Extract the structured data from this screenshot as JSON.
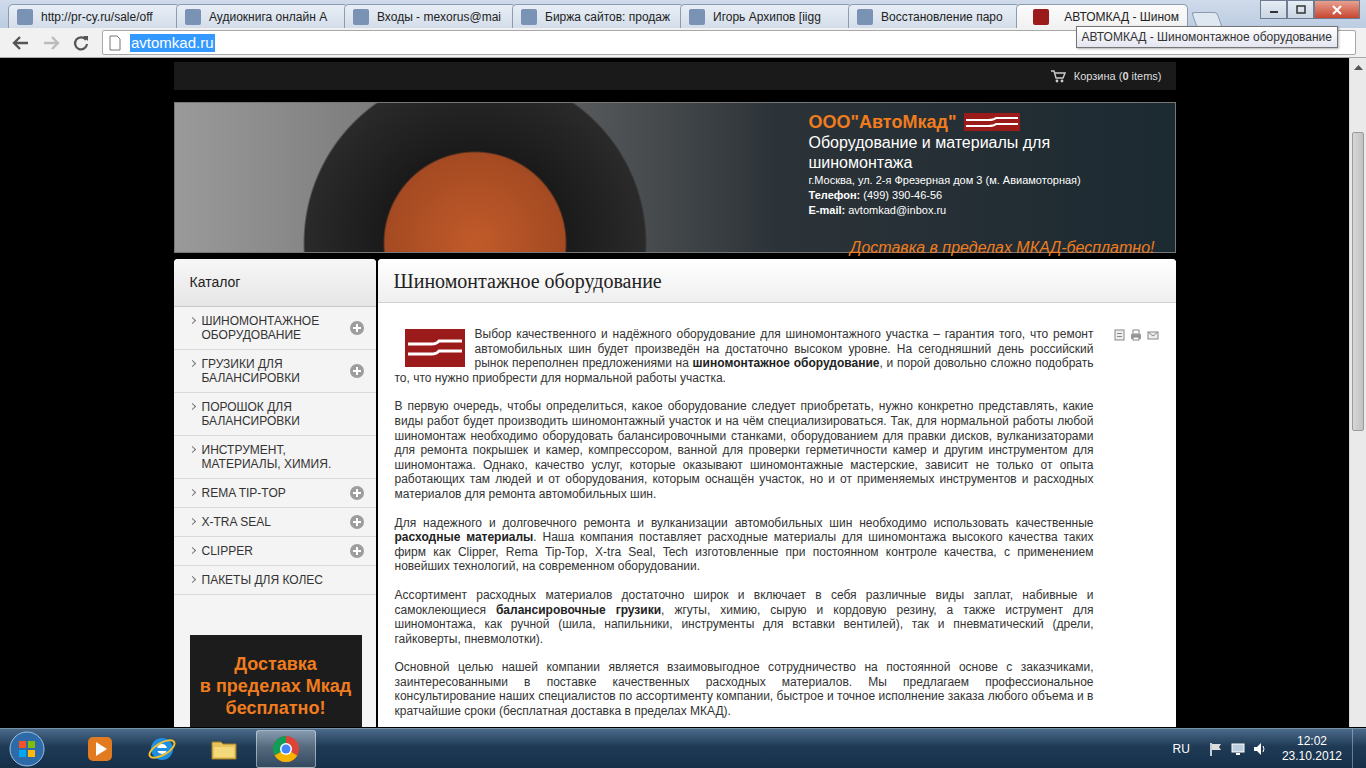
{
  "browser": {
    "tabs": [
      {
        "label": "http://pr-cy.ru/sale/off",
        "selected": false
      },
      {
        "label": "Аудиокнига онлайн А",
        "selected": false
      },
      {
        "label": "Входы - mexorus@mai",
        "selected": false
      },
      {
        "label": "Биржа сайтов: продаж",
        "selected": false
      },
      {
        "label": "Игорь Архипов [iigg",
        "selected": false
      },
      {
        "label": "Восстановление паро",
        "selected": false
      },
      {
        "label": "АВТОМКАД - Шином",
        "selected": true
      }
    ],
    "tooltip": "АВТОМКАД - Шиномонтажное оборудование",
    "url": "avtomkad.ru",
    "url_selected": true,
    "scrollbar": {
      "thumb_start": 0.09,
      "thumb_size": 0.47
    }
  },
  "site": {
    "cart": {
      "prefix": "Корзина (",
      "count": "0",
      "suffix": " items)"
    },
    "header": {
      "company": "ООО\"АвтоМкад\"",
      "subtitle": "Оборудование и материалы для шиномонтажа",
      "address": "г.Москва, ул. 2-я Фрезерная дом 3 (м. Авиамоторная)",
      "phone_label": "Телефон:",
      "phone": " (499) 390-46-56",
      "email_label": "E-mail:",
      "email": " avtomkad@inbox.ru",
      "delivery": "Доставка в пределах МКАД-бесплатно!"
    },
    "sidebar": {
      "title": "Каталог",
      "items": [
        {
          "label": "ШИНОМОНТАЖНОЕ ОБОРУДОВАНИЕ",
          "has_children": true
        },
        {
          "label": "ГРУЗИКИ ДЛЯ БАЛАНСИРОВКИ",
          "has_children": true
        },
        {
          "label": "ПОРОШОК ДЛЯ БАЛАНСИРОВКИ",
          "has_children": false
        },
        {
          "label": "ИНСТРУМЕНТ, МАТЕРИАЛЫ, ХИМИЯ.",
          "has_children": false
        },
        {
          "label": "REMA TIP-TOP",
          "has_children": true
        },
        {
          "label": "X-TRA SEAL",
          "has_children": true
        },
        {
          "label": "CLIPPER",
          "has_children": true
        },
        {
          "label": "ПАКЕТЫ ДЛЯ КОЛЕС",
          "has_children": false
        }
      ],
      "promo_lines": [
        "Доставка",
        "в пределах Мкад",
        "бесплатно!"
      ]
    },
    "content": {
      "title": "Шиномонтажное оборудование",
      "paragraphs": [
        [
          {
            "text": "Выбор качественного и надёжного оборудование для шиномонтажного участка – гарантия того, что ремонт автомобильных шин будет произведён на достаточно высоком уровне. На сегодняшний день российский рынок переполнен предложениями на ",
            "bold": false
          },
          {
            "text": "шиномонтажное оборудование",
            "bold": true
          },
          {
            "text": ", и порой довольно сложно подобрать то, что нужно приобрести для нормальной работы участка.",
            "bold": false
          }
        ],
        [
          {
            "text": "В первую очередь, чтобы определиться, какое оборудование следует приобретать, нужно конкретно представлять, какие виды работ будет производить шиномонтажный участок и на чём специализироваться. Так, для нормальной работы любой шиномонтаж необходимо оборудовать балансировочными станками, оборудованием для правки дисков, вулканизаторами для ремонта покрышек и камер, компрессором, ванной для проверки герметичности камер и другим инструментом для шиномонтажа. Однако, качество услуг, которые оказывают шиномонтажные мастерские, зависит не только от опыта работающих там людей и от оборудования, которым оснащён участок, но и от применяемых инструментов и расходных материалов для ремонта автомобильных шин.",
            "bold": false
          }
        ],
        [
          {
            "text": "Для надежного и долговечного ремонта и вулканизации автомобильных шин необходимо использовать качественные ",
            "bold": false
          },
          {
            "text": "расходные материалы",
            "bold": true
          },
          {
            "text": ". Наша компания поставляет расходные материалы для шиномонтажа высокого качества таких фирм как Clipper, Rema Tip-Top, X-tra Seal, Tech изготовленные при постоянном контроле качества, с применением новейших технологий, на современном оборудовании.",
            "bold": false
          }
        ],
        [
          {
            "text": "Ассортимент расходных материалов достаточно широк и включает в себя различные виды заплат, набивные и самоклеющиеся ",
            "bold": false
          },
          {
            "text": "балансировочные грузики",
            "bold": true
          },
          {
            "text": ", жгуты, химию, сырую и кордовую резину, а также иструмент для шиномонтажа, как ручной (шила, напильники, инструменты для вставки вентилей), так и пневматический (дрели, гайковерты, пневмолотки).",
            "bold": false
          }
        ],
        [
          {
            "text": "Основной целью нашей компании является взаимовыгодное сотрудничество на постоянной основе с заказчиками, заинтересованными в поставке качественных расходных материалов. Мы предлагаем профессиональное консультирование наших специалистов по ассортименту компании, быстрое и точное исполнение заказа любого объема и в кратчайшие сроки (бесплатная доставка в пределах МКАД).",
            "bold": false
          }
        ]
      ]
    }
  },
  "taskbar": {
    "apps": [
      {
        "kind": "media",
        "active": false
      },
      {
        "kind": "ie",
        "active": false
      },
      {
        "kind": "explorer",
        "active": false
      },
      {
        "kind": "chrome",
        "active": true
      }
    ],
    "language": "RU",
    "time": "12:02",
    "date": "23.10.2012"
  }
}
